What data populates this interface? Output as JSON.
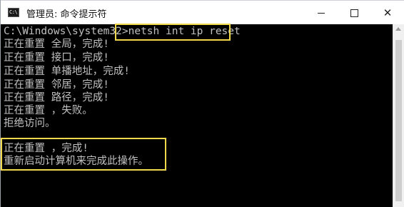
{
  "window": {
    "title": "管理员: 命令提示符",
    "icon": "cmd-icon",
    "icon_glyph": "C:\\",
    "buttons": {
      "minimize": "minimize-icon",
      "maximize": "maximize-icon",
      "close": "✕"
    }
  },
  "console": {
    "prompt": "C:\\Windows\\system32>",
    "command": "netsh int ip reset",
    "lines": [
      "正在重置 全局，完成!",
      "正在重置 接口，完成!",
      "正在重置 单播地址，完成!",
      "正在重置 邻居，完成!",
      "正在重置 路径，完成!",
      "正在重置 ，失败。",
      "拒绝访问。"
    ],
    "result_lines": [
      "正在重置 ，完成!",
      "重新启动计算机来完成此操作。"
    ]
  },
  "colors": {
    "console_text": "#c0c0c0",
    "console_background": "#000000",
    "highlight_border": "#f0d84a"
  }
}
